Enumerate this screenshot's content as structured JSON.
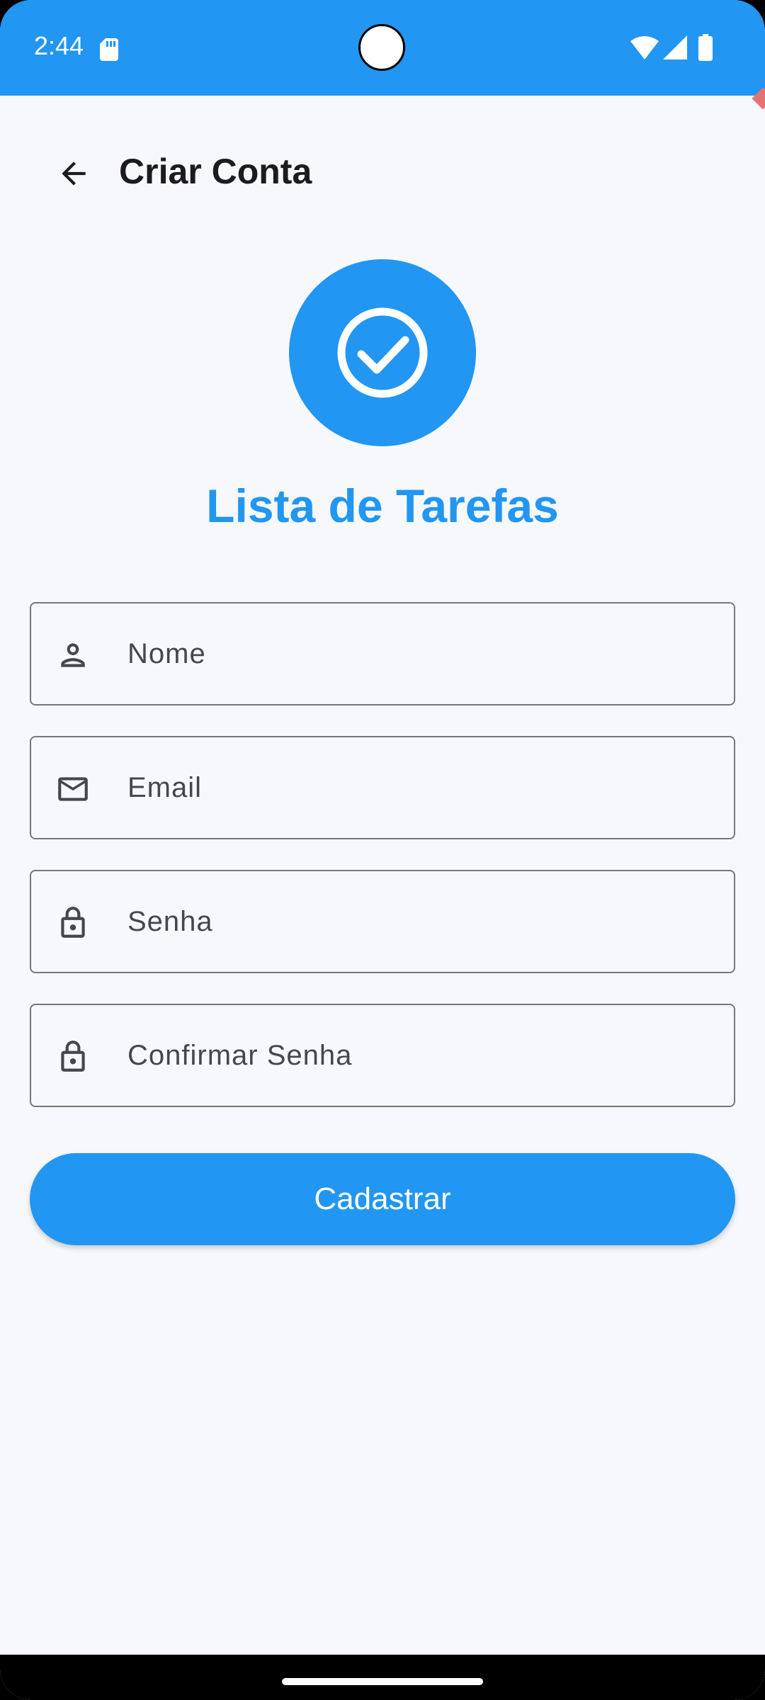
{
  "status_bar": {
    "time": "2:44",
    "icons": [
      "sd-card-icon",
      "wifi-icon",
      "signal-icon",
      "battery-icon"
    ]
  },
  "app_bar": {
    "back_icon": "arrow-back-icon",
    "title": "Criar Conta"
  },
  "logo": {
    "icon": "check-circle-icon",
    "app_name": "Lista de Tarefas"
  },
  "form": {
    "fields": [
      {
        "icon": "person-icon",
        "placeholder": "Nome",
        "value": ""
      },
      {
        "icon": "mail-icon",
        "placeholder": "Email",
        "value": ""
      },
      {
        "icon": "lock-icon",
        "placeholder": "Senha",
        "value": ""
      },
      {
        "icon": "lock-icon",
        "placeholder": "Confirmar Senha",
        "value": ""
      }
    ],
    "submit_label": "Cadastrar"
  },
  "colors": {
    "primary": "#2196f3",
    "background": "#f7f8fc",
    "outline": "#74777f",
    "on_surface": "#1c1c1f"
  }
}
